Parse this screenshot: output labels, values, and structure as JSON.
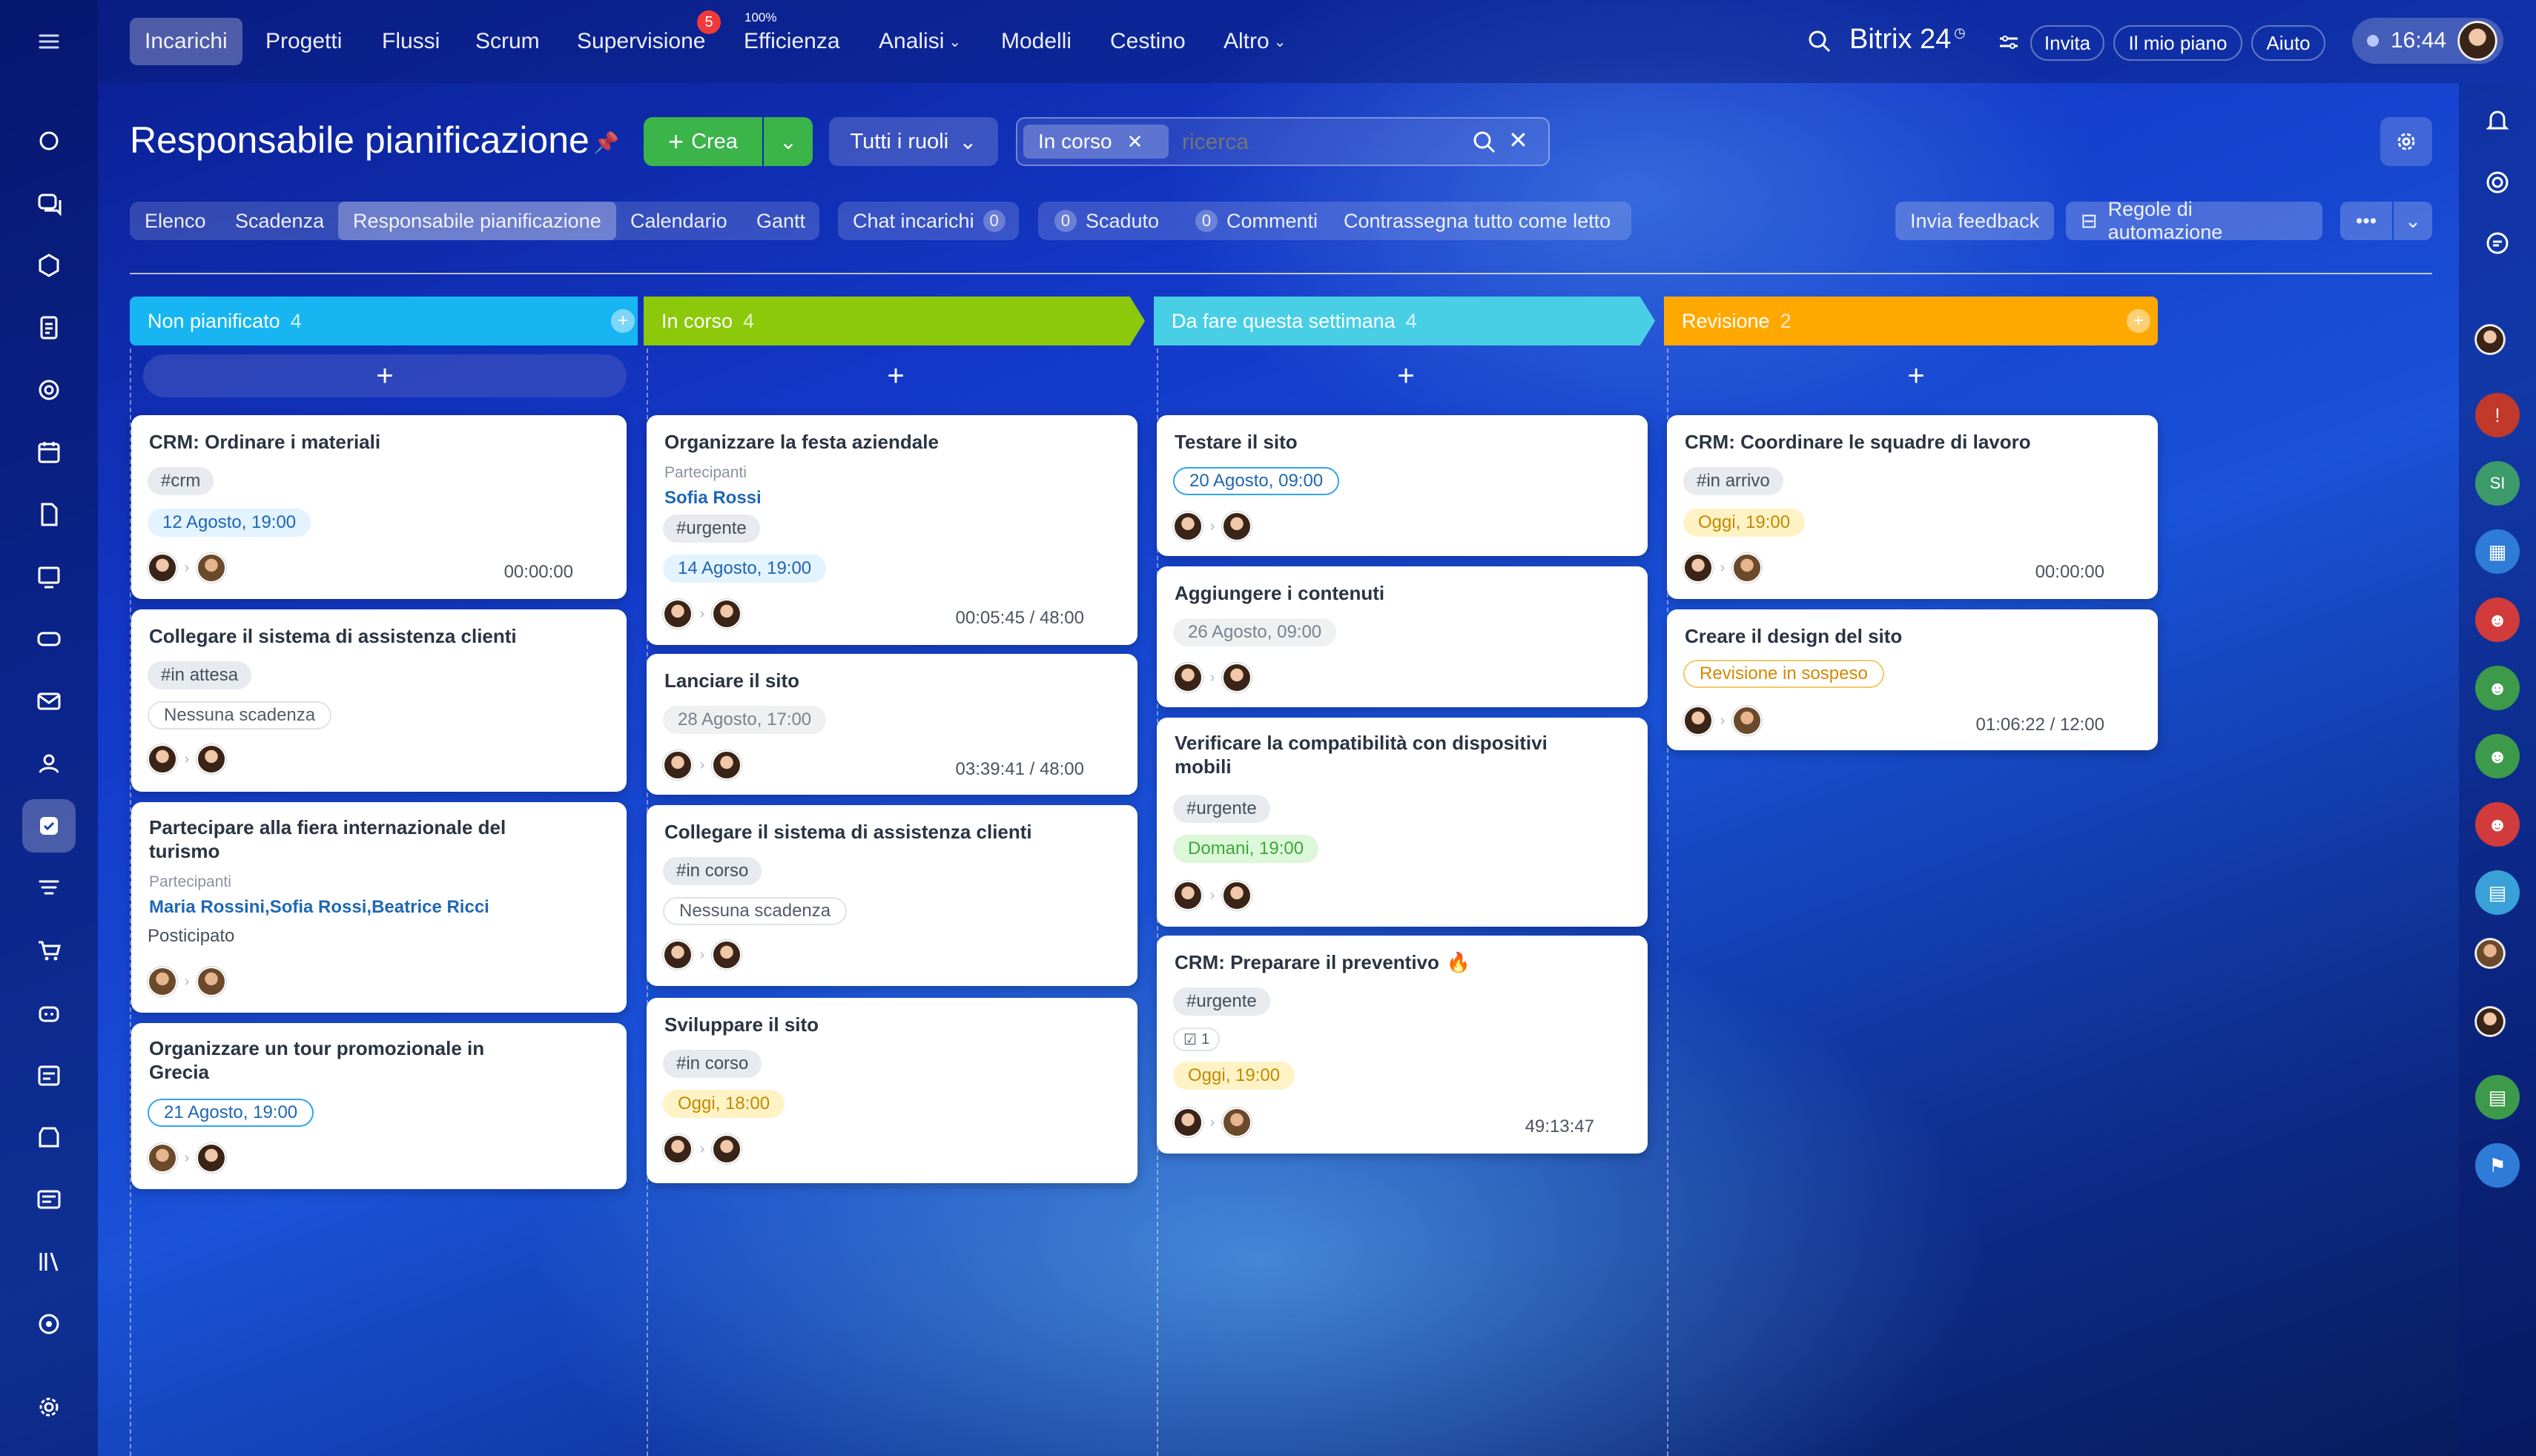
{
  "nav": {
    "items": [
      "Incarichi",
      "Progetti",
      "Flussi",
      "Scrum",
      "Supervisione",
      "Efficienza",
      "Analisi",
      "Modelli",
      "Cestino",
      "Altro"
    ],
    "supervision_badge": "5",
    "efficiency_pct": "100%"
  },
  "brand": {
    "name": "Bitrix 24",
    "invite": "Invita",
    "plan": "Il mio piano",
    "help": "Aiuto",
    "time": "16:44"
  },
  "page": {
    "title": "Responsabile pianificazione",
    "create": "Crea",
    "roles": "Tutti i ruoli",
    "filter_chip": "In corso",
    "search_placeholder": "ricerca"
  },
  "views": [
    "Elenco",
    "Scadenza",
    "Responsabile pianificazione",
    "Calendario",
    "Gantt"
  ],
  "counters": {
    "chat_label": "Chat incarichi",
    "chat_count": "0",
    "overdue_count": "0",
    "overdue_label": "Scaduto",
    "comments_count": "0",
    "comments_label": "Commenti",
    "mark_read": "Contrassegna tutto come letto"
  },
  "actions": {
    "feedback": "Invia feedback",
    "automation": "Regole di automazione",
    "more": "•••"
  },
  "columns": [
    {
      "title": "Non pianificato",
      "count": "4",
      "color": "#17b6f3"
    },
    {
      "title": "In corso",
      "count": "4",
      "color": "#8cc90a"
    },
    {
      "title": "Da fare questa settimana",
      "count": "4",
      "color": "#48cfe6"
    },
    {
      "title": "Revisione",
      "count": "2",
      "color": "#ffa900"
    }
  ],
  "add": "+",
  "labels": {
    "participants": "Partecipanti"
  },
  "cards": {
    "c1": {
      "title": "CRM: Ordinare i materiali",
      "tag": "#crm",
      "date": "12 Agosto, 19:00",
      "timer": "00:00:00"
    },
    "c2": {
      "title": "Collegare il sistema di assistenza clienti",
      "tag": "#in attesa",
      "date": "Nessuna scadenza"
    },
    "c3": {
      "title1": "Partecipare alla fiera internazionale del",
      "title2": "turismo",
      "names": "Maria Rossini,Sofia Rossi,Beatrice Ricci",
      "tag": "Posticipato"
    },
    "c4": {
      "title1": "Organizzare un tour promozionale in",
      "title2": "Grecia",
      "date": "21 Agosto, 19:00"
    },
    "c5": {
      "title": "Organizzare la festa aziendale",
      "names": "Sofia Rossi",
      "tag": "#urgente",
      "date": "14 Agosto, 19:00",
      "timer": "00:05:45 / 48:00"
    },
    "c6": {
      "title": "Lanciare il sito",
      "date": "28 Agosto, 17:00",
      "timer": "03:39:41 / 48:00"
    },
    "c7": {
      "title": "Collegare il sistema di assistenza clienti",
      "tag": "#in corso",
      "date": "Nessuna scadenza"
    },
    "c8": {
      "title": "Sviluppare il sito",
      "tag": "#in corso",
      "date": "Oggi, 18:00"
    },
    "c9": {
      "title": "Testare il sito",
      "date": "20 Agosto, 09:00"
    },
    "c10": {
      "title": "Aggiungere i contenuti",
      "date": "26 Agosto, 09:00"
    },
    "c11": {
      "title1": "Verificare la compatibilità con dispositivi",
      "title2": "mobili",
      "tag": "#urgente",
      "date": "Domani, 19:00"
    },
    "c12": {
      "title": "CRM: Preparare il preventivo",
      "tag": "#urgente",
      "checklist": "1",
      "date": "Oggi, 19:00",
      "timer": "49:13:47"
    },
    "c13": {
      "title": "CRM: Coordinare le squadre di lavoro",
      "tag": "#in arrivo",
      "date": "Oggi, 19:00",
      "timer": "00:00:00"
    },
    "c14": {
      "title": "Creare il design del sito",
      "date": "Revisione in sospeso",
      "timer": "01:06:22 / 12:00"
    }
  },
  "rightbar": {
    "si": "SI"
  }
}
